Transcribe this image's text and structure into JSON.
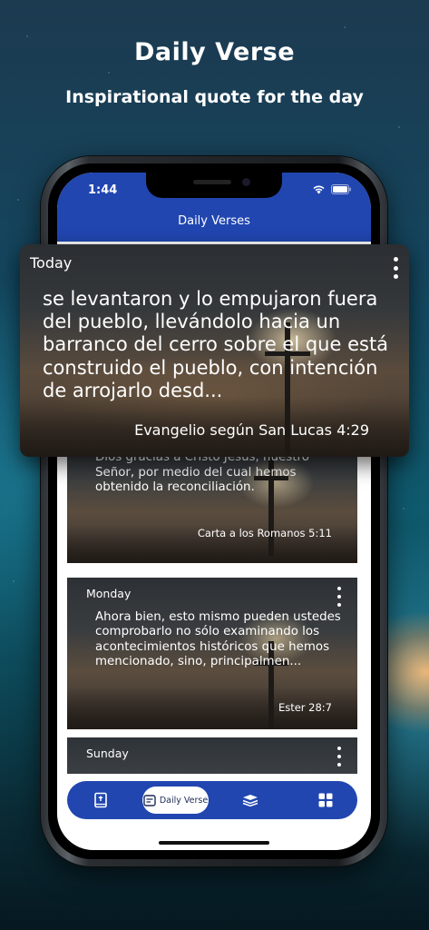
{
  "hero": {
    "title": "Daily Verse",
    "subtitle": "Inspirational quote for the day"
  },
  "status_bar": {
    "time": "1:44"
  },
  "app_bar": {
    "title": "Daily Verses"
  },
  "featured_card": {
    "day": "Today",
    "verse": "se levantaron y lo empujaron fuera del pueblo, llevándolo hacia un barranco del cerro sobre el que está construido el pueblo, con intención de arrojarlo desd...",
    "reference": "Evangelio según San Lucas 4:29"
  },
  "cards": [
    {
      "day": "",
      "verse": "No sólo eso: nos sentiremos seguros de Dios gracias a Cristo Jesús, nuestro Señor, por medio del cual hemos obtenido la reconciliación.",
      "reference": "Carta a los Romanos 5:11"
    },
    {
      "day": "Monday",
      "verse": "Ahora bien, esto mismo pueden ustedes comprobarlo no sólo examinando los acontecimientos históricos que hemos mencionado, sino, principalmen...",
      "reference": "Ester 28:7"
    },
    {
      "day": "Sunday",
      "verse": "",
      "reference": ""
    }
  ],
  "bottom_nav": {
    "active_label": "Daily Verse",
    "items": [
      "bible-icon",
      "daily-verse-icon",
      "study-icon",
      "grid-icon"
    ]
  },
  "colors": {
    "app_blue": "#2146b0",
    "text_white": "#ffffff"
  }
}
